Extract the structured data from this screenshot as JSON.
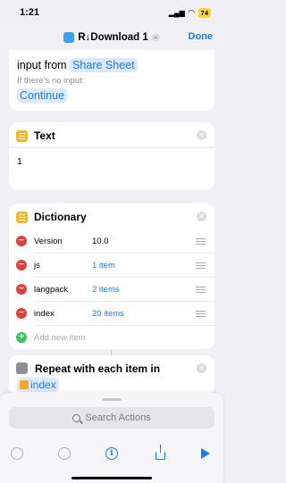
{
  "status": {
    "time": "1:21",
    "battery": "74"
  },
  "nav": {
    "title": "R↓Download 1",
    "done": "Done"
  },
  "receive_card": {
    "input_from_label": "input from",
    "source_token": "Share Sheet",
    "no_input_label": "If there’s no input:",
    "no_input_action": "Continue"
  },
  "text_card": {
    "title": "Text",
    "value": "1"
  },
  "dict_card": {
    "title": "Dictionary",
    "rows": [
      {
        "key": "Version",
        "value": "10.0"
      },
      {
        "key": "js",
        "value": "1 item"
      },
      {
        "key": "langpack",
        "value": "2 items"
      },
      {
        "key": "index",
        "value": "20 items"
      }
    ],
    "add_label": "Add new item"
  },
  "repeat_card": {
    "title": "Repeat with each item in",
    "variable": "index"
  },
  "bottom": {
    "search_placeholder": "Search Actions"
  },
  "colors": {
    "accent": "#1a7cf5",
    "remove": "#e2403a",
    "add": "#34c759",
    "text_icon": "#f5b630"
  }
}
